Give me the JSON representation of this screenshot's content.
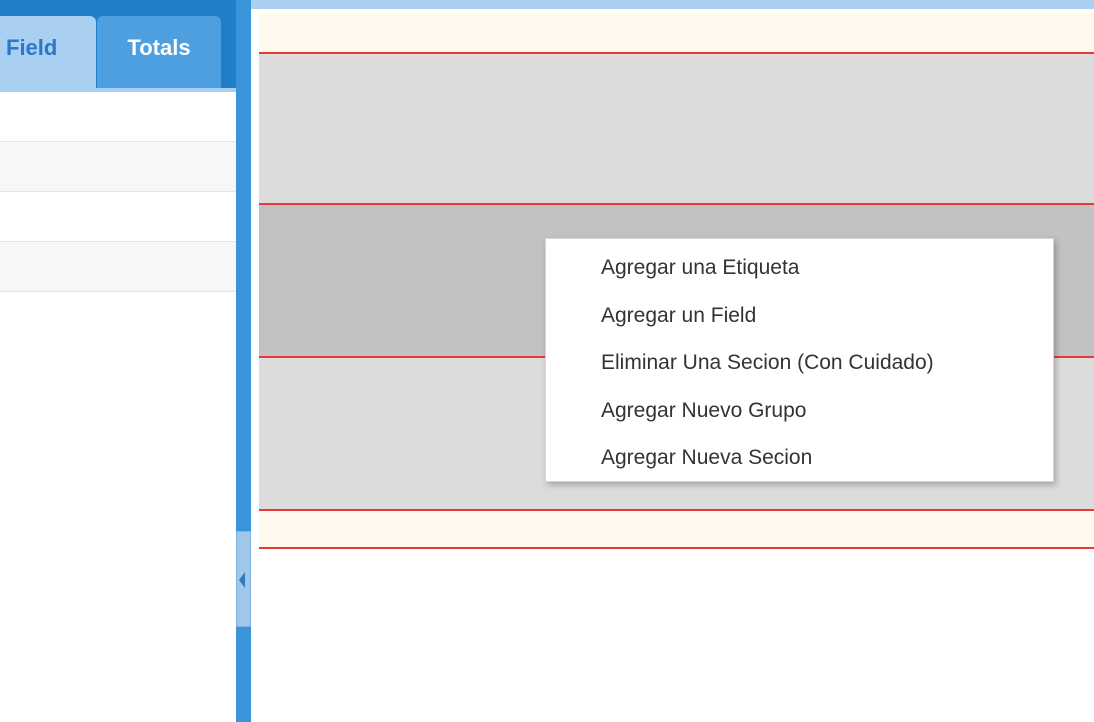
{
  "left_panel": {
    "tabs": [
      {
        "label": "Field",
        "active": true
      },
      {
        "label": "Totals",
        "active": false
      }
    ]
  },
  "context_menu": {
    "items": [
      {
        "label": "Agregar una Etiqueta"
      },
      {
        "label": "Agregar un Field"
      },
      {
        "label": "Eliminar Una Secion (Con Cuidado)"
      },
      {
        "label": "Agregar Nuevo Grupo"
      },
      {
        "label": "Agregar Nueva Secion"
      }
    ]
  },
  "colors": {
    "panel_blue": "#3a94d9",
    "active_tab": "#a9cff1",
    "inactive_tab": "#4e9fdf",
    "band_separator": "#e83a3a",
    "band_header_footer": "#fff8ec",
    "band_light": "#dcdcdc",
    "band_selected": "#c2c2c2"
  }
}
